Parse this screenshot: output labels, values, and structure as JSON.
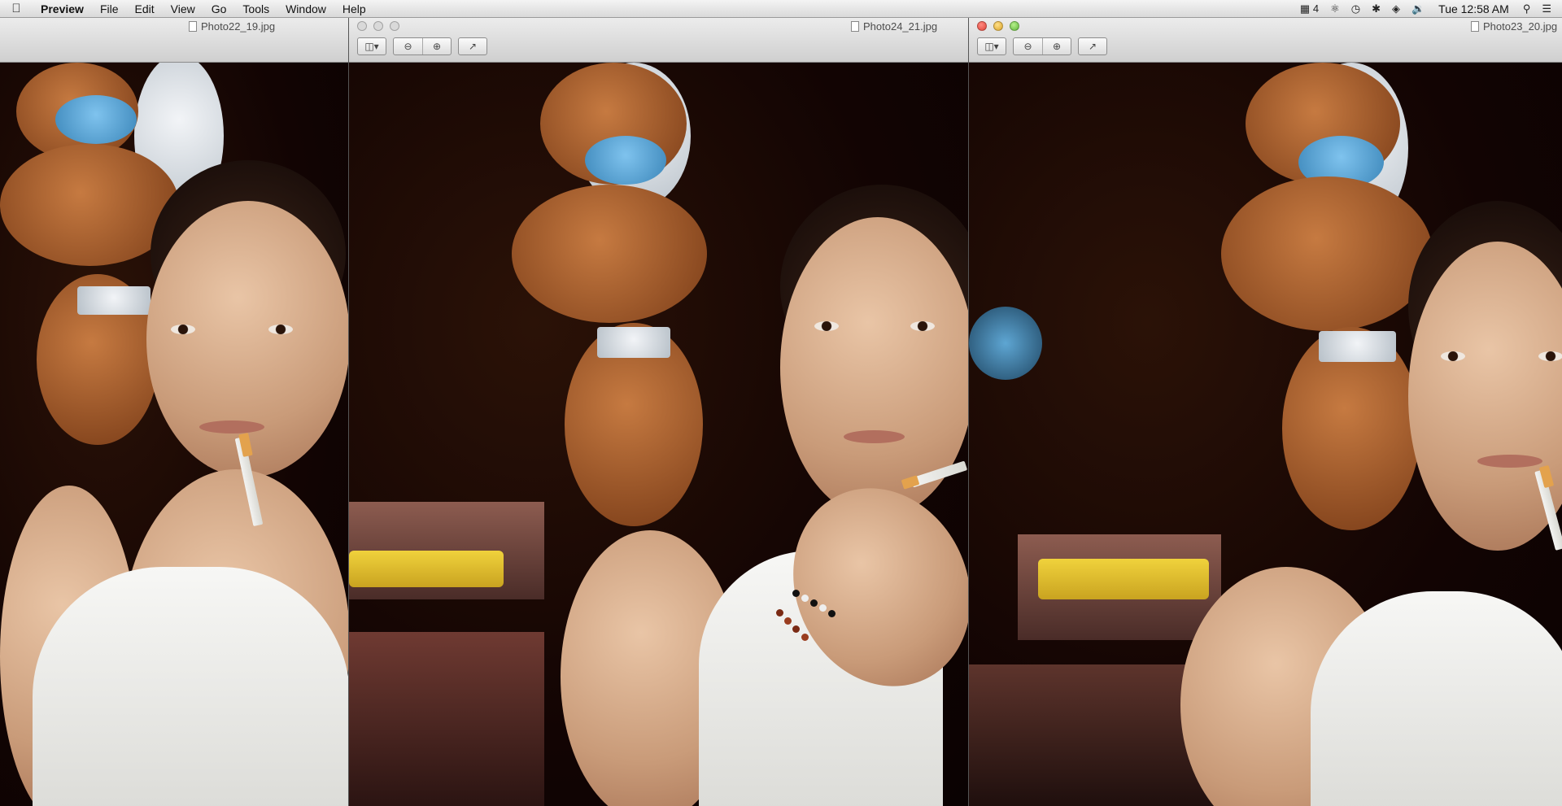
{
  "menubar": {
    "app_name": "Preview",
    "menus": [
      "File",
      "Edit",
      "View",
      "Go",
      "Tools",
      "Window",
      "Help"
    ],
    "status": {
      "input_menu": "4",
      "clock": "Tue 12:58 AM"
    }
  },
  "windows": [
    {
      "title": "Photo22_19.jpg",
      "active": false
    },
    {
      "title": "Photo24_21.jpg",
      "active": false
    },
    {
      "title": "Photo23_20.jpg",
      "active": true
    }
  ],
  "icons": {
    "apple": "apple-icon",
    "zoom_out": "zoom-out-icon",
    "zoom_in": "zoom-in-icon",
    "share": "share-icon",
    "sidebar": "sidebar-toggle-icon"
  },
  "colors": {
    "close": "#e0443a",
    "minimize": "#dba428",
    "zoom": "#5fb83a"
  }
}
